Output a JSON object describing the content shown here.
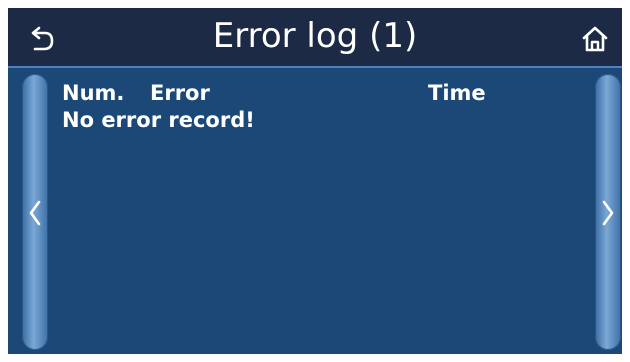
{
  "header": {
    "title": "Error log (1)",
    "back_icon": "back-arrow-icon",
    "home_icon": "home-icon"
  },
  "table": {
    "columns": [
      "Num.",
      "Error",
      "Time"
    ],
    "empty_message": "No error record!"
  },
  "nav": {
    "prev_icon": "chevron-left-icon",
    "next_icon": "chevron-right-icon"
  },
  "colors": {
    "background": "#1c4877",
    "header": "#1d2a45",
    "text": "#ffffff"
  }
}
